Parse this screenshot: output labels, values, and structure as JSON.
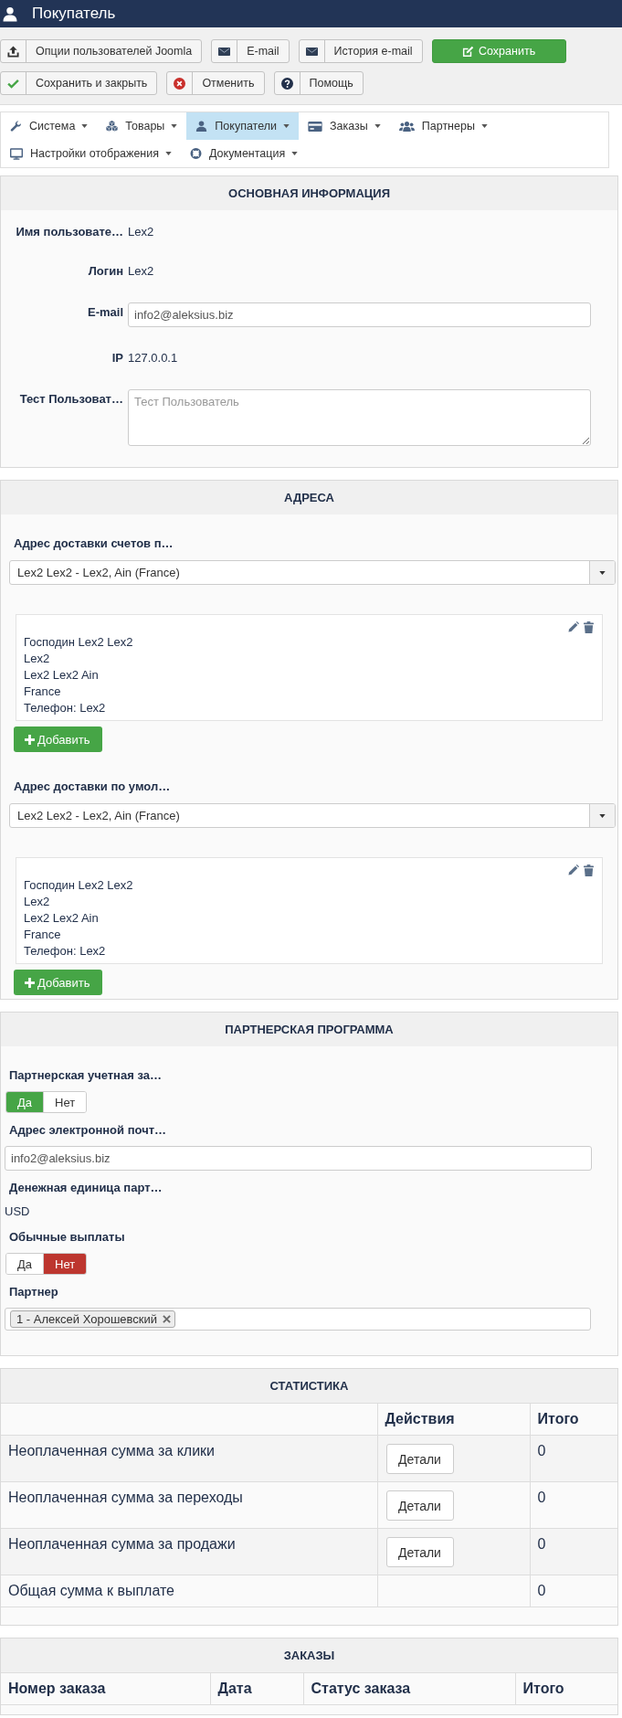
{
  "header": {
    "title": "Покупатель"
  },
  "toolbar": {
    "buttons": [
      {
        "label": "Опции пользователей Joomla",
        "kind": "default"
      },
      {
        "label": "E-mail",
        "kind": "default"
      },
      {
        "label": "История e-mail",
        "kind": "default"
      },
      {
        "label": "Сохранить",
        "kind": "success"
      },
      {
        "label": "Сохранить и закрыть",
        "kind": "default"
      },
      {
        "label": "Отменить",
        "kind": "default"
      },
      {
        "label": "Помощь",
        "kind": "default"
      }
    ]
  },
  "menu": {
    "items": [
      {
        "label": "Система",
        "selected": false
      },
      {
        "label": "Товары",
        "selected": false
      },
      {
        "label": "Покупатели",
        "selected": true
      },
      {
        "label": "Заказы",
        "selected": false
      },
      {
        "label": "Партнеры",
        "selected": false
      },
      {
        "label": "Настройки отображения",
        "selected": false
      },
      {
        "label": "Документация",
        "selected": false
      }
    ]
  },
  "basic_info": {
    "title": "ОСНОВНАЯ ИНФОРМАЦИЯ",
    "fields": [
      {
        "kind": "text",
        "label": "Имя пользовате…",
        "value": "Lex2"
      },
      {
        "kind": "text",
        "label": "Логин",
        "value": "Lex2"
      },
      {
        "kind": "input",
        "label": "E-mail",
        "value": "info2@aleksius.biz"
      },
      {
        "kind": "text",
        "label": "IP",
        "value": "127.0.0.1"
      },
      {
        "kind": "textarea",
        "label": "Тест Пользоват…",
        "placeholder": "Тест Пользователь"
      }
    ]
  },
  "addresses": {
    "title": "АДРЕСА",
    "groups": [
      {
        "label": "Адрес доставки счетов п…",
        "selected_address": "Lex2 Lex2 - Lex2, Ain (France)",
        "card_lines": [
          "Господин Lex2 Lex2",
          "Lex2",
          "Lex2 Lex2 Ain",
          "France",
          "Телефон: Lex2"
        ],
        "add_button": "Добавить"
      },
      {
        "label": "Адрес доставки по умол…",
        "selected_address": "Lex2 Lex2 - Lex2, Ain (France)",
        "card_lines": [
          "Господин Lex2 Lex2",
          "Lex2",
          "Lex2 Lex2 Ain",
          "France",
          "Телефон: Lex2"
        ],
        "add_button": "Добавить"
      }
    ]
  },
  "partner_program": {
    "title": "ПАРТНЕРСКАЯ ПРОГРАММА",
    "fields": [
      {
        "kind": "toggle",
        "label": "Партнерская учетная за…",
        "options": [
          {
            "label": "Да",
            "selected": true
          },
          {
            "label": "Нет",
            "selected": false
          }
        ]
      },
      {
        "kind": "input",
        "label": "Адрес электронной почт…",
        "value": "info2@aleksius.biz"
      },
      {
        "kind": "text",
        "label": "Денежная единица парт…",
        "value": "USD"
      },
      {
        "kind": "toggle",
        "label": "Обычные выплаты",
        "options": [
          {
            "label": "Да",
            "selected": false
          },
          {
            "label": "Нет",
            "selected": true
          }
        ]
      },
      {
        "kind": "tags",
        "label": "Партнер",
        "tags": [
          "1 - Алексей Хорошевский"
        ]
      }
    ]
  },
  "statistics": {
    "title": "СТАТИСТИКА",
    "columns": [
      "Действия",
      "Итого"
    ],
    "rows": [
      {
        "label": "Неоплаченная сумма за клики",
        "action": "Детали",
        "total": "0"
      },
      {
        "label": "Неоплаченная сумма за переходы",
        "action": "Детали",
        "total": "0"
      },
      {
        "label": "Неоплаченная сумма за продажи",
        "action": "Детали",
        "total": "0"
      },
      {
        "label": "Общая сумма к выплате",
        "total": "0"
      }
    ]
  },
  "orders": {
    "title": "ЗАКАЗЫ",
    "columns": [
      "Номер заказа",
      "Дата",
      "Статус заказа",
      "Итого"
    ]
  }
}
